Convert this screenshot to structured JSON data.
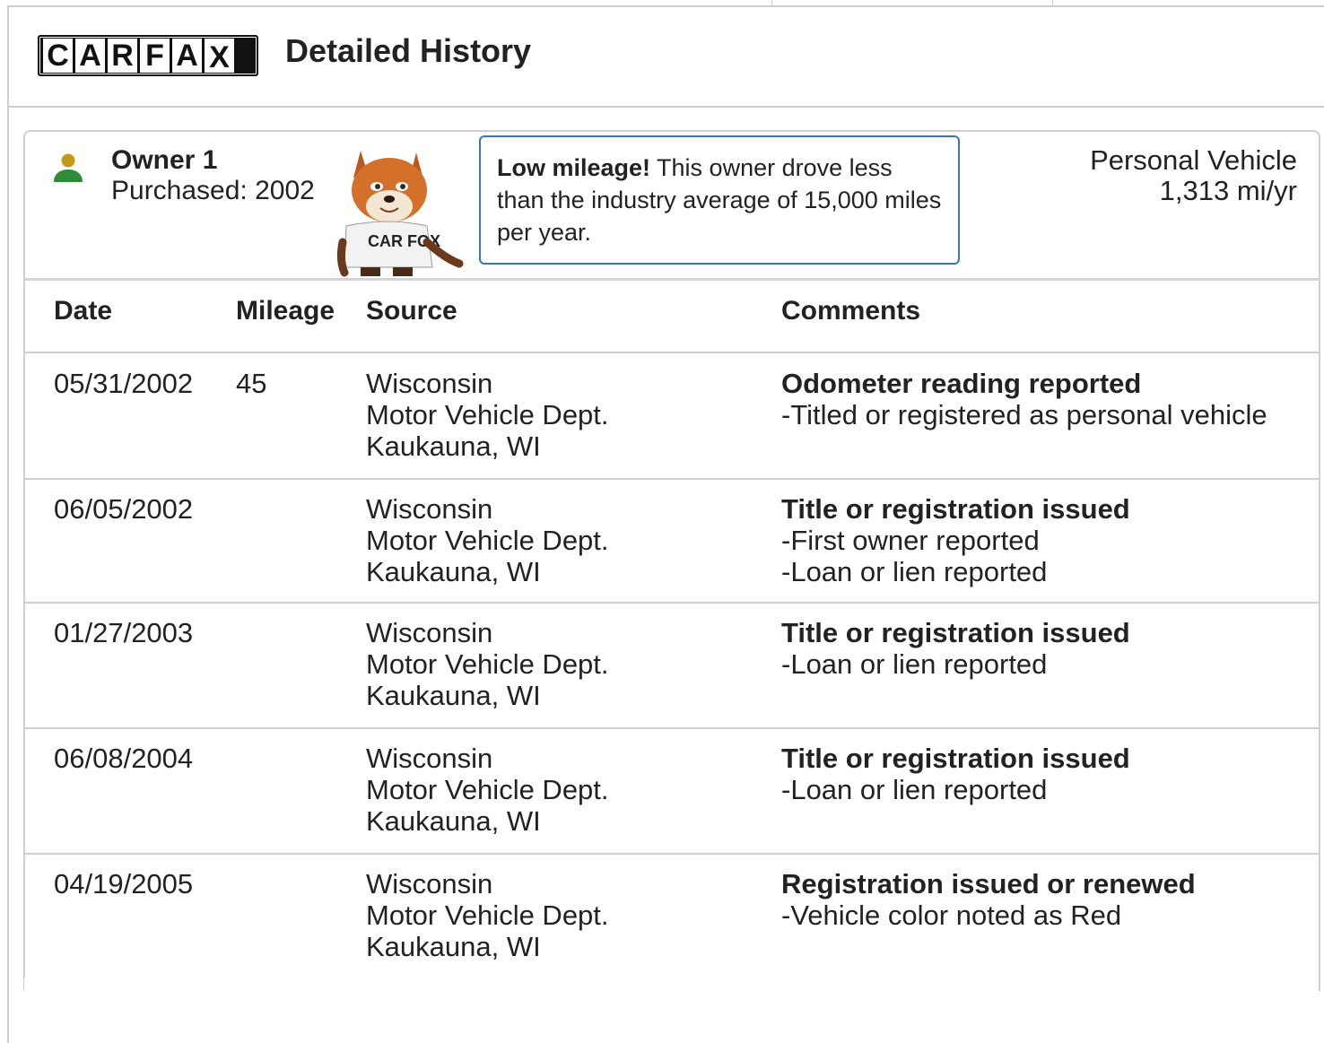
{
  "header": {
    "logo_letters": [
      "C",
      "A",
      "R",
      "F",
      "A",
      "X"
    ],
    "title": "Detailed History"
  },
  "owner": {
    "name": "Owner 1",
    "purchased": "Purchased: 2002",
    "icon": "person-icon",
    "icon_colors": {
      "head": "#c19a1a",
      "body": "#2e8b3a"
    },
    "mascot_shirt_text": "CAR FOX"
  },
  "callout": {
    "bold": "Low mileage!",
    "text": " This owner drove less than the industry average of 15,000 miles per year.",
    "border_color": "#3777bc"
  },
  "usage": {
    "type": "Personal Vehicle",
    "rate": "1,313 mi/yr"
  },
  "table": {
    "headers": {
      "date": "Date",
      "mileage": "Mileage",
      "source": "Source",
      "comments": "Comments"
    },
    "rows": [
      {
        "date": "05/31/2002",
        "mileage": "45",
        "source": [
          "Wisconsin",
          "Motor Vehicle Dept.",
          "Kaukauna, WI"
        ],
        "comment_title": "Odometer reading reported",
        "comment_items": [
          "Titled or registered as personal vehicle"
        ]
      },
      {
        "date": "06/05/2002",
        "mileage": "",
        "source": [
          "Wisconsin",
          "Motor Vehicle Dept.",
          "Kaukauna, WI"
        ],
        "comment_title": "Title or registration issued",
        "comment_items": [
          "First owner reported",
          "Loan or lien reported"
        ]
      },
      {
        "date": "01/27/2003",
        "mileage": "",
        "source": [
          "Wisconsin",
          "Motor Vehicle Dept.",
          "Kaukauna, WI"
        ],
        "comment_title": "Title or registration issued",
        "comment_items": [
          "Loan or lien reported"
        ]
      },
      {
        "date": "06/08/2004",
        "mileage": "",
        "source": [
          "Wisconsin",
          "Motor Vehicle Dept.",
          "Kaukauna, WI"
        ],
        "comment_title": "Title or registration issued",
        "comment_items": [
          "Loan or lien reported"
        ]
      },
      {
        "date": "04/19/2005",
        "mileage": "",
        "source": [
          "Wisconsin",
          "Motor Vehicle Dept.",
          "Kaukauna, WI"
        ],
        "comment_title": "Registration issued or renewed",
        "comment_items": [
          "Vehicle color noted as Red"
        ]
      }
    ]
  }
}
